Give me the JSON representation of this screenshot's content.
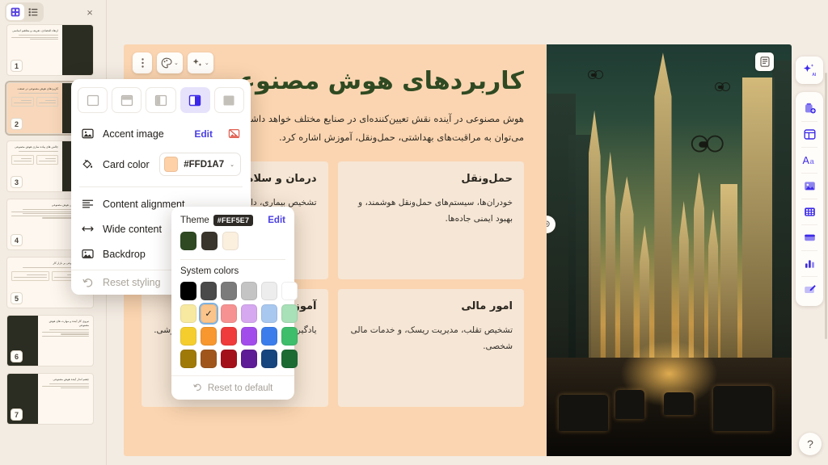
{
  "panel": {
    "grid_view_icon": "grid-view-icon",
    "list_view_icon": "list-view-icon",
    "close_icon": "×",
    "slides": [
      {
        "num": "1",
        "title": "ارتقاء اقتصادی، تعریف و مفاهیم اساسی",
        "image": "img-statue",
        "accent": false,
        "layout": "image-right"
      },
      {
        "num": "2",
        "title": "کاربردهای هوش مصنوعی در صنعت",
        "image": "img-city2",
        "accent": true,
        "layout": "cards-image"
      },
      {
        "num": "3",
        "title": "چالش های پیاده سازی هوش مصنوعی",
        "image": "img-gold",
        "accent": false,
        "layout": "cards-image"
      },
      {
        "num": "4",
        "title": "اخلاق و حکمرانی هوش مصنوعی",
        "image": "",
        "accent": false,
        "layout": "list"
      },
      {
        "num": "5",
        "title": "تاثیر هوش مصنوعی بر بازار کار",
        "image": "",
        "accent": false,
        "layout": "list"
      },
      {
        "num": "6",
        "title": "نیروی کار آینده و مهارت های هوش مصنوعی",
        "image": "img-people",
        "accent": false,
        "layout": "image-left"
      },
      {
        "num": "7",
        "title": "چشم انداز آینده هوش مصنوعی",
        "image": "img-teal",
        "accent": false,
        "layout": "image-left"
      }
    ]
  },
  "toolbar": {
    "drag_icon": "drag-dots-icon",
    "palette_icon": "palette-icon",
    "ai_icon": "ai-sparkle-icon",
    "chevron": "⌄"
  },
  "slide": {
    "title": "کاربردهای هوش مصنوعی",
    "subtitle_line1": "هوش مصنوعی در آینده نقش تعیین‌کننده‌ای در صنایع مختلف خواهد داشت.",
    "subtitle_line2": "می‌توان به مراقبت‌های بهداشتی، حمل‌ونقل، آموزش اشاره کرد.",
    "cards": [
      {
        "title": "حمل‌ونقل",
        "body": "خودران‌ها، سیستم‌های حمل‌ونقل هوشمند، و بهبود ایمنی جاده‌ها."
      },
      {
        "title": "درمان و سلامت",
        "body": "تشخیص بیماری، داروسازی و پایش بیمار."
      },
      {
        "title": "امور مالی",
        "body": "تشخیص تقلب، مدیریت ریسک، و خدمات مالی شخصی."
      },
      {
        "title": "آموزش",
        "body": "یادگیری شخصی‌سازی شده و دستیار آموزشی."
      }
    ],
    "image_alt": "futuristic-city-with-drones-and-cars",
    "image_card_icon": "card-icon",
    "drag_handle_icon": "drag-handle-icon"
  },
  "style_popup": {
    "layouts": [
      {
        "name": "layout-full",
        "active": false
      },
      {
        "name": "layout-bottom",
        "active": false
      },
      {
        "name": "layout-left-narrow",
        "active": false
      },
      {
        "name": "layout-right-split",
        "active": true
      },
      {
        "name": "layout-fill",
        "active": false
      }
    ],
    "rows": [
      {
        "name": "accent-image",
        "icon": "image-icon",
        "label": "Accent image",
        "action": "Edit",
        "extra": "image-off-icon"
      },
      {
        "name": "card-color",
        "icon": "paint-bucket-icon",
        "label": "Card color",
        "value": "#FFD1A7",
        "swatch": "#FFD1A7"
      },
      {
        "name": "content-alignment",
        "icon": "align-icon",
        "label": "Content alignment"
      },
      {
        "name": "wide-content",
        "icon": "arrows-horizontal-icon",
        "label": "Wide content"
      },
      {
        "name": "backdrop",
        "icon": "backdrop-icon",
        "label": "Backdrop"
      },
      {
        "name": "reset-styling",
        "icon": "reset-icon",
        "label": "Reset styling"
      }
    ]
  },
  "color_picker": {
    "theme_label": "Theme",
    "theme_tooltip": "#FEF5E7",
    "edit_label": "Edit",
    "theme_colors": [
      "#2F4A22",
      "#3A352C",
      "#FBEFDE"
    ],
    "system_label": "System colors",
    "system_colors": [
      "#000000",
      "#4A4A4A",
      "#7B7B7B",
      "#C4C4C4",
      "#EDEDED",
      "#FFFFFF",
      "#F7E9A0",
      "#FBC48A",
      "#F79292",
      "#D6A8F0",
      "#A8C8F0",
      "#A8E0B8",
      "#F5CE2E",
      "#F7972E",
      "#EF3B3B",
      "#A24DEB",
      "#3B7EEB",
      "#3EBD6B",
      "#A07A08",
      "#A0561B",
      "#A4101A",
      "#5E1C96",
      "#17467E",
      "#1B6B33"
    ],
    "selected_index": 7,
    "selected_check": "✓",
    "reset_label": "Reset to default",
    "reset_icon": "reset-icon"
  },
  "right_rail": {
    "ai_button": {
      "name": "ai-assistant-button",
      "icon": "ai-sparkle-icon"
    },
    "tools": [
      {
        "name": "add-card-button",
        "icon": "add-card-icon"
      },
      {
        "name": "layout-button",
        "icon": "layout-icon"
      },
      {
        "name": "text-button",
        "icon": "text-aa-icon"
      },
      {
        "name": "image-button",
        "icon": "image-icon"
      },
      {
        "name": "table-button",
        "icon": "table-icon"
      },
      {
        "name": "card-button",
        "icon": "card-icon"
      },
      {
        "name": "chart-button",
        "icon": "chart-bar-icon"
      },
      {
        "name": "draw-button",
        "icon": "pencil-edit-icon"
      }
    ]
  },
  "help": {
    "label": "?"
  }
}
